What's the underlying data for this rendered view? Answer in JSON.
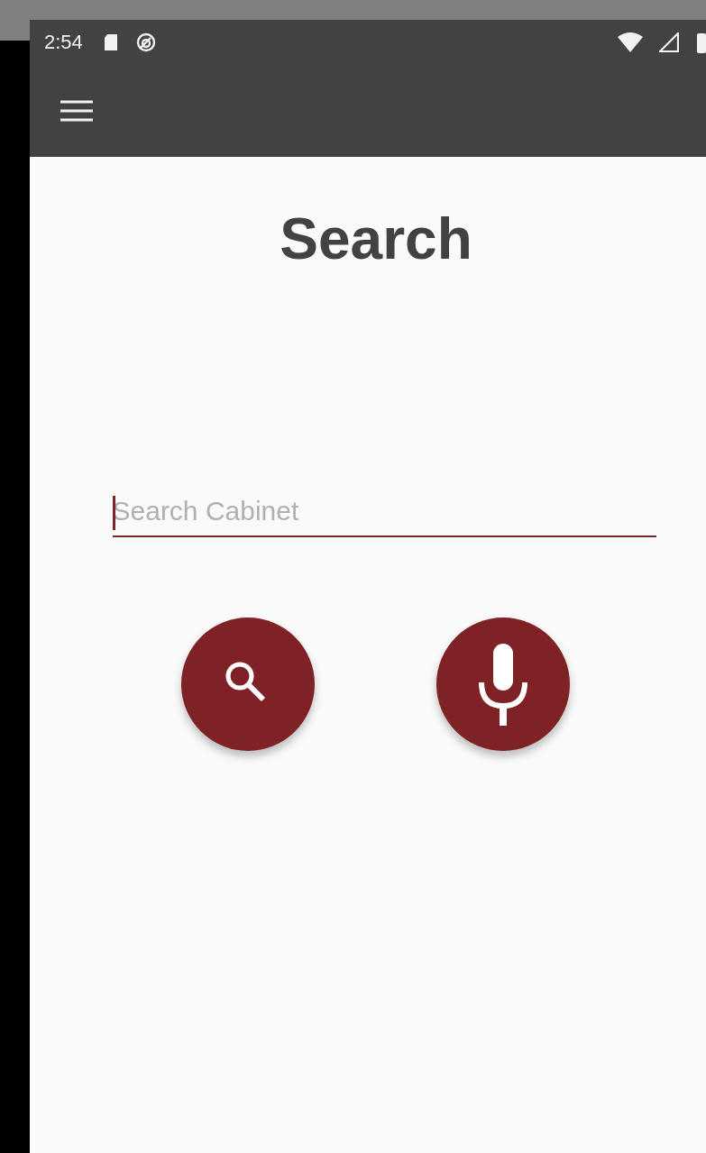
{
  "status_bar": {
    "time": "2:54"
  },
  "title": "Search",
  "search": {
    "placeholder": "Search Cabinet",
    "focused": true
  }
}
